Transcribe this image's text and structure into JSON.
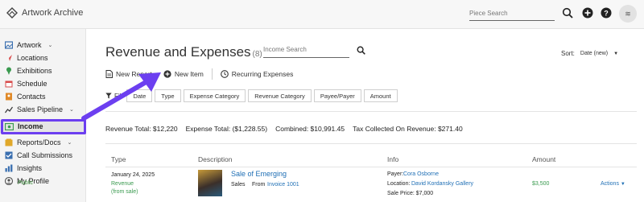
{
  "app": {
    "name": "Artwork Archive"
  },
  "header": {
    "search_placeholder": "Piece Search",
    "icons": [
      "search-icon",
      "plus-circle-icon",
      "help-icon",
      "avatar"
    ],
    "avatar_initials": "≋"
  },
  "sidebar": {
    "items": [
      {
        "label": "Artwork",
        "icon": "artwork-icon",
        "chevron": true,
        "color": "#3a6fb0"
      },
      {
        "label": "Locations",
        "icon": "location-pin-icon",
        "color": "#d94a4a"
      },
      {
        "label": "Exhibitions",
        "icon": "map-pin-icon",
        "color": "#3a9a4f"
      },
      {
        "label": "Schedule",
        "icon": "calendar-icon",
        "color": "#d94a4a"
      },
      {
        "label": "Contacts",
        "icon": "contacts-icon",
        "color": "#e08a2a"
      },
      {
        "label": "Sales Pipeline",
        "icon": "chart-line-icon",
        "chevron": true,
        "color": "#333333"
      },
      {
        "label": "Income",
        "icon": "income-icon",
        "active": true,
        "color": "#3a9a4f"
      },
      {
        "label": "Reports/Docs",
        "icon": "reports-icon",
        "chevron": true,
        "color": "#e0a82a"
      },
      {
        "label": "Call Submissions",
        "icon": "submissions-icon",
        "color": "#3a6fb0"
      },
      {
        "label": "Insights",
        "icon": "insights-icon",
        "color": "#3a6fb0"
      },
      {
        "label": "My Profile",
        "icon": "profile-icon",
        "color": "#555555"
      }
    ],
    "profile_sub": "Public"
  },
  "main": {
    "title": "Revenue and Expenses",
    "count": "(8)",
    "income_search_placeholder": "Income Search",
    "sort_label": "Sort:",
    "sort_value": "Date (new)",
    "actions": {
      "new_report": "New Report",
      "new_item": "New Item",
      "recurring": "Recurring Expenses"
    },
    "filter_label": "Fil",
    "filters": [
      "Date",
      "Type",
      "Expense Category",
      "Revenue Category",
      "Payee/Payer",
      "Amount"
    ],
    "totals": {
      "revenue": "Revenue Total: $12,220",
      "expense": "Expense Total: ($1,228.55)",
      "combined": "Combined: $10,991.45",
      "tax": "Tax Collected On Revenue: $271.40"
    },
    "columns": [
      "Type",
      "Description",
      "Info",
      "Amount"
    ],
    "rows": [
      {
        "date": "January 24, 2025",
        "type": "Revenue",
        "type_sub": "(from sale)",
        "title": "Sale of Emerging",
        "desc_kind": "Sales",
        "desc_from_label": "From",
        "desc_from": "Invoice 1001",
        "payer_label": "Payer:",
        "payer": "Cora Osborne",
        "location_label": "Location:",
        "location": "David Kordansky Gallery",
        "sale_price": "Sale Price: $7,000",
        "amount": "$3,500",
        "actions": "Actions"
      }
    ]
  },
  "colors": {
    "accent": "#6c3ff0",
    "link": "#1f6fb5",
    "green": "#3a9a4f"
  }
}
